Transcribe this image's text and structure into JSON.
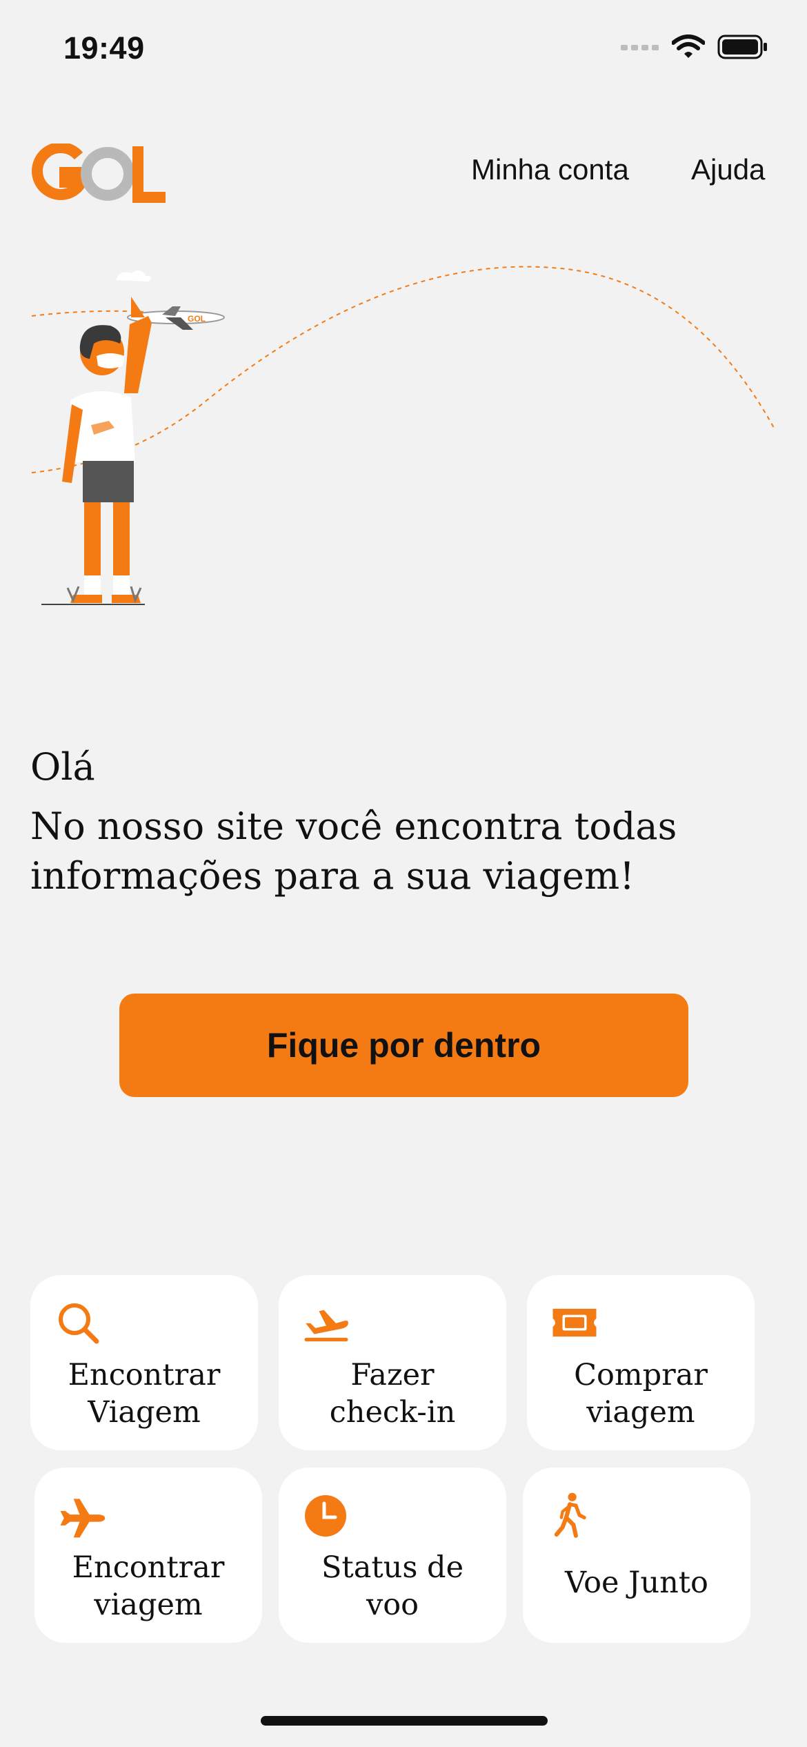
{
  "status_bar": {
    "time": "19:49"
  },
  "header": {
    "logo_text": "GOL",
    "account_link": "Minha conta",
    "help_link": "Ajuda"
  },
  "hero": {
    "plane_logo_text": "GOL"
  },
  "greeting": {
    "title": "Olá",
    "text": "No nosso site você encontra todas informações para a sua viagem!"
  },
  "cta": {
    "label": "Fique por dentro"
  },
  "tiles": [
    {
      "label": "Encontrar\nViagem",
      "icon": "search-icon"
    },
    {
      "label": "Fazer\ncheck-in",
      "icon": "plane-departure-icon"
    },
    {
      "label": "Comprar\nviagem",
      "icon": "ticket-icon"
    },
    {
      "label": "Encontrar\nviagem",
      "icon": "airplane-icon"
    },
    {
      "label": "Status de\nvoo",
      "icon": "clock-icon"
    },
    {
      "label": "Voe Junto",
      "icon": "walking-person-icon"
    }
  ],
  "colors": {
    "brand_orange": "#f47a14",
    "background": "#f2f2f2",
    "tile_background": "#ffffff",
    "logo_gray": "#b9b9b9"
  }
}
